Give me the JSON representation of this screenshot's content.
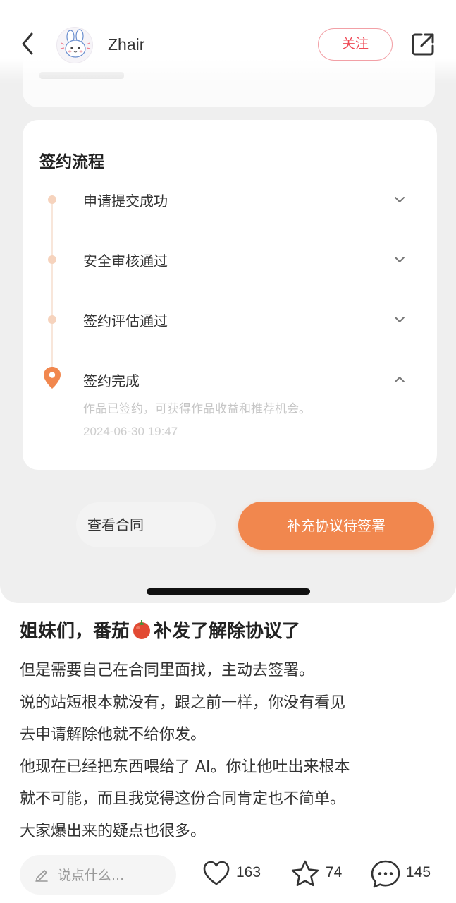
{
  "header": {
    "username": "Zhair",
    "follow_label": "关注"
  },
  "process": {
    "title": "签约流程",
    "steps": [
      {
        "label": "申请提交成功",
        "state": "done",
        "expanded": false
      },
      {
        "label": "安全审核通过",
        "state": "done",
        "expanded": false
      },
      {
        "label": "签约评估通过",
        "state": "done",
        "expanded": false
      },
      {
        "label": "签约完成",
        "state": "current",
        "expanded": true,
        "description": "作品已签约，可获得作品收益和推荐机会。",
        "time": "2024-06-30 19:47"
      }
    ],
    "view_contract_label": "查看合同",
    "sign_button_label": "补充协议待签署"
  },
  "post": {
    "title_before": "姐妹们，番茄",
    "title_after": "补发了解除协议了",
    "lines": [
      "但是需要自己在合同里面找，主动去签署。",
      "说的站短根本就没有，跟之前一样，你没有看见",
      "去申请解除他就不给你发。",
      "他现在已经把东西喂给了 AI。你让他吐出来根本",
      "就不可能，而且我觉得这份合同肯定也不简单。",
      "大家爆出来的疑点也很多。"
    ]
  },
  "bottom_bar": {
    "comment_placeholder": "说点什么...",
    "likes": "163",
    "stars": "74",
    "comments": "145"
  },
  "colors": {
    "accent_orange": "#f1874e",
    "follow_red": "#ef4b57",
    "timeline_dot": "#f6d3bd"
  },
  "icons": [
    "back-icon",
    "share-icon",
    "chevron-down-icon",
    "chevron-up-icon",
    "location-pin-icon",
    "tomato-icon",
    "pencil-icon",
    "heart-icon",
    "star-icon",
    "comment-icon"
  ]
}
